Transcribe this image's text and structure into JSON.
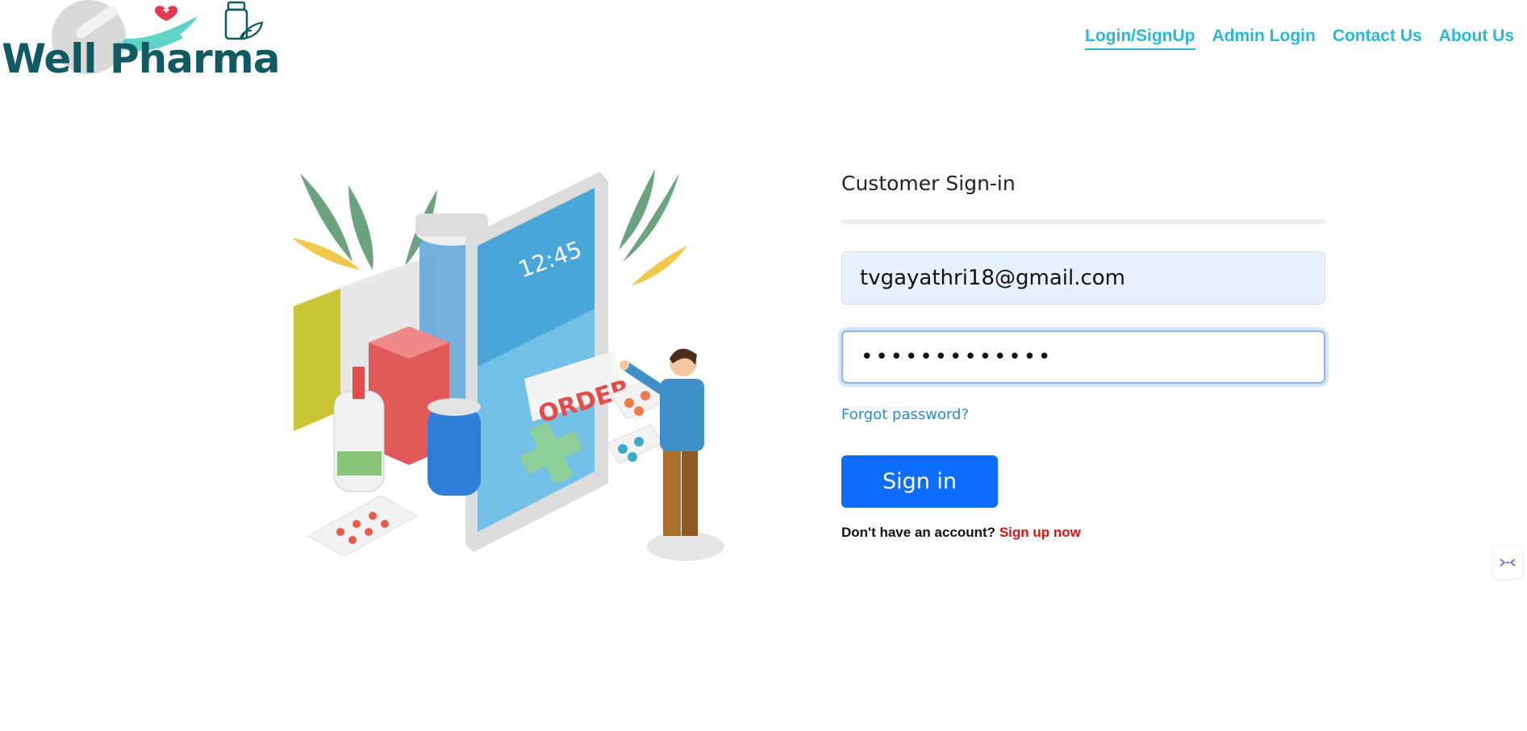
{
  "brand": {
    "name": "Well Pharma"
  },
  "nav": [
    {
      "label": "Login/SignUp",
      "active": true
    },
    {
      "label": "Admin Login",
      "active": false
    },
    {
      "label": "Contact Us",
      "active": false
    },
    {
      "label": "About Us",
      "active": false
    }
  ],
  "illustration": {
    "order_label": "ORDER",
    "phone_time": "12:45"
  },
  "form": {
    "title": "Customer Sign-in",
    "email_value": "tvgayathri18@gmail.com",
    "password_value": "•••••••••••••",
    "forgot_label": "Forgot password?",
    "signin_label": "Sign in",
    "no_account_text": "Don't have an account?",
    "signup_label": "Sign up now"
  },
  "colors": {
    "nav_link": "#29b6d8",
    "brand_text": "#0f5a63",
    "primary_button": "#0d6efd",
    "signup_link": "#e01010",
    "email_field_bg": "#e8f0fe"
  },
  "icons": {
    "logo": "pill-heart-hand-logo",
    "widget": "chat-widget-icon"
  }
}
